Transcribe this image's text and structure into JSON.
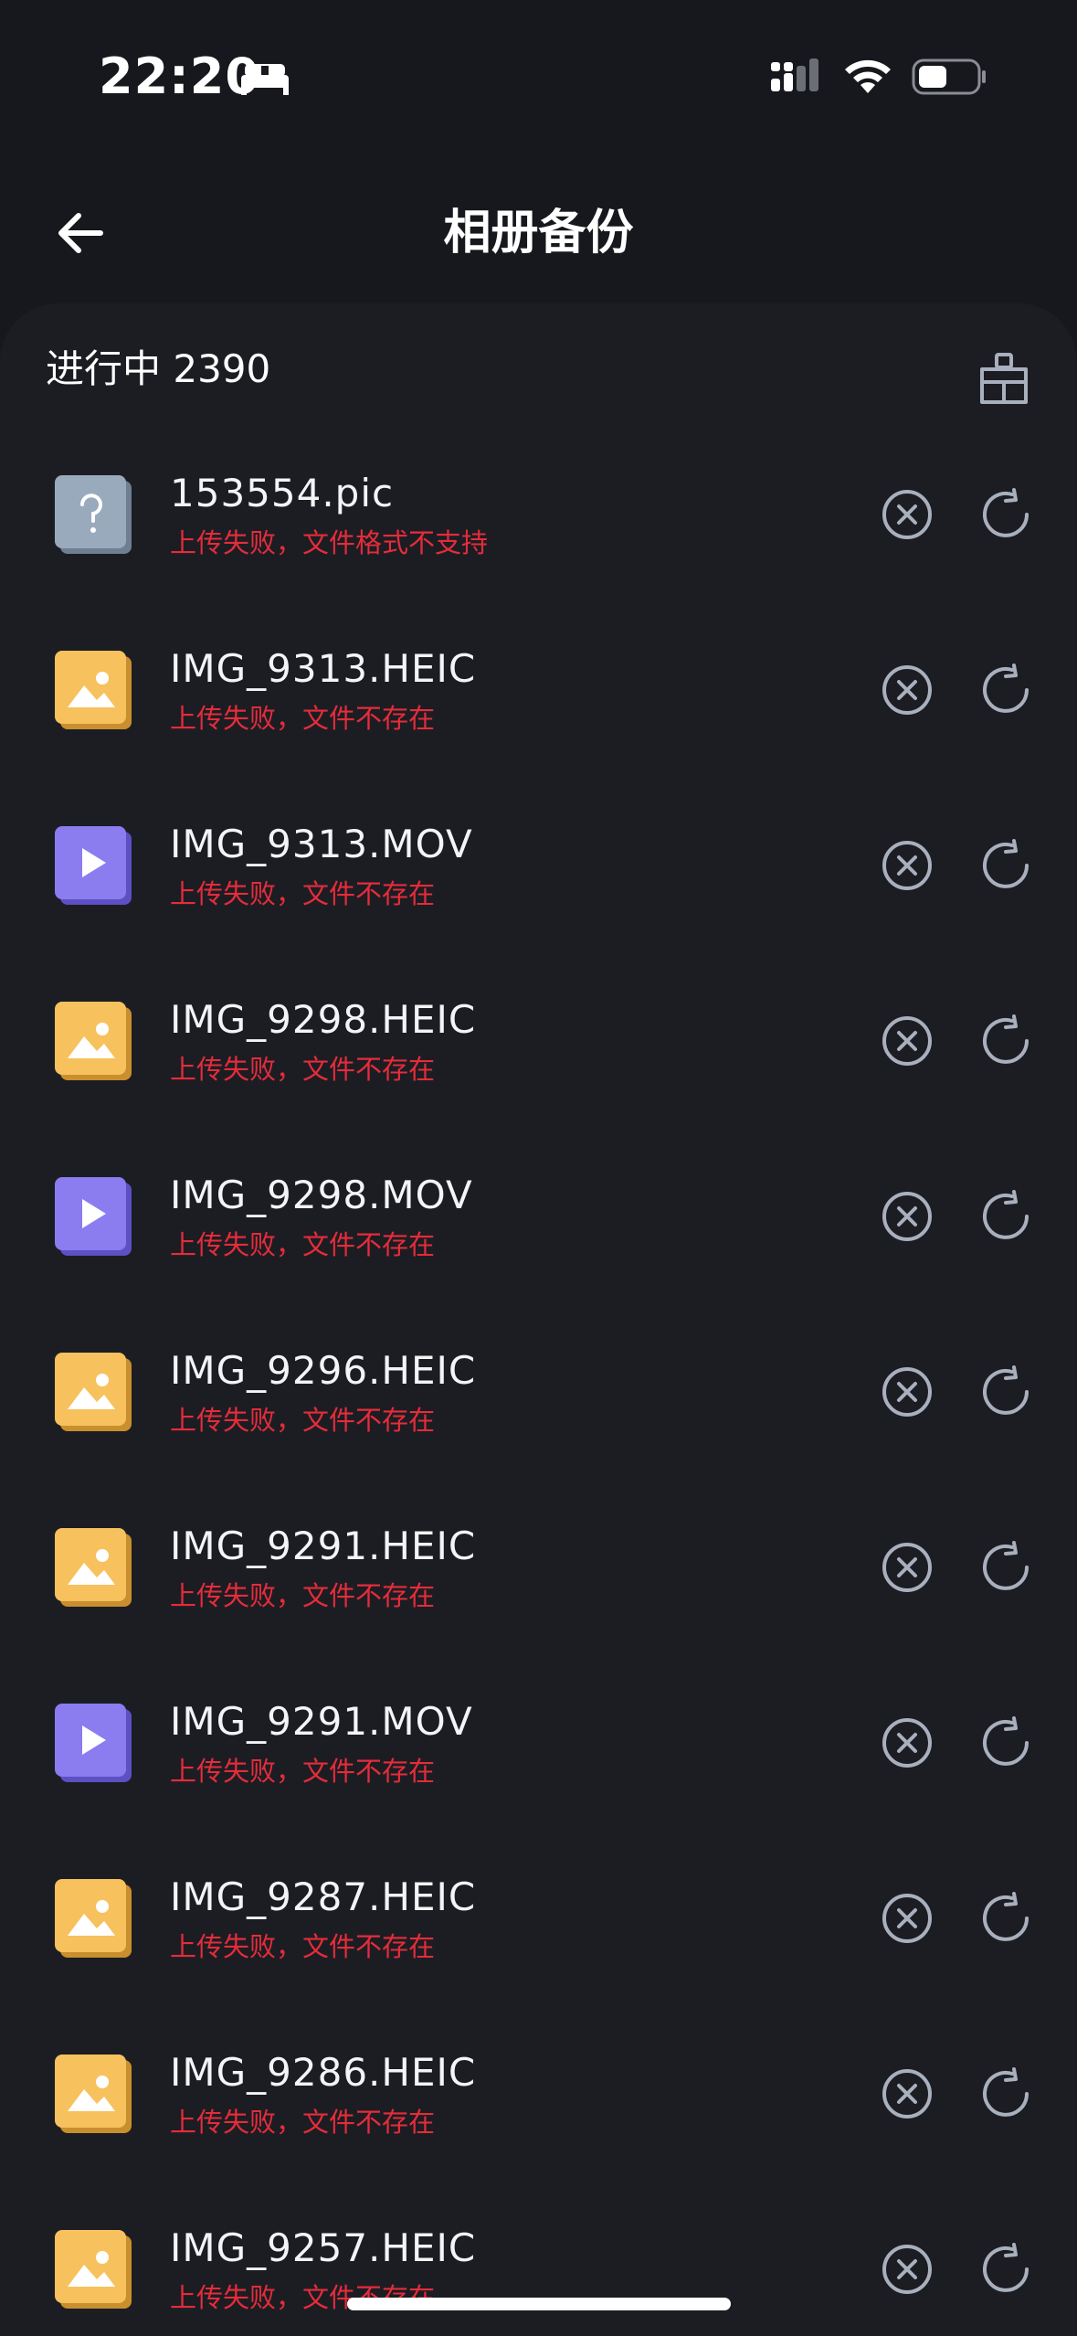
{
  "status_bar": {
    "time": "22:20",
    "icons": [
      "bed-icon",
      "cellular-signal-icon",
      "wifi-icon",
      "battery-icon"
    ]
  },
  "header": {
    "title": "相册备份",
    "back_icon": "arrow-left-icon"
  },
  "section": {
    "label": "进行中 2390",
    "clean_icon": "broom-icon"
  },
  "files": [
    {
      "name": "153554.pic",
      "status": "上传失败，文件格式不支持",
      "type": "unknown"
    },
    {
      "name": "IMG_9313.HEIC",
      "status": "上传失败，文件不存在",
      "type": "image"
    },
    {
      "name": "IMG_9313.MOV",
      "status": "上传失败，文件不存在",
      "type": "video"
    },
    {
      "name": "IMG_9298.HEIC",
      "status": "上传失败，文件不存在",
      "type": "image"
    },
    {
      "name": "IMG_9298.MOV",
      "status": "上传失败，文件不存在",
      "type": "video"
    },
    {
      "name": "IMG_9296.HEIC",
      "status": "上传失败，文件不存在",
      "type": "image"
    },
    {
      "name": "IMG_9291.HEIC",
      "status": "上传失败，文件不存在",
      "type": "image"
    },
    {
      "name": "IMG_9291.MOV",
      "status": "上传失败，文件不存在",
      "type": "video"
    },
    {
      "name": "IMG_9287.HEIC",
      "status": "上传失败，文件不存在",
      "type": "image"
    },
    {
      "name": "IMG_9286.HEIC",
      "status": "上传失败，文件不存在",
      "type": "image"
    },
    {
      "name": "IMG_9257.HEIC",
      "status": "上传失败，文件不存在",
      "type": "image"
    }
  ],
  "colors": {
    "background": "#16181d",
    "panel": "#1c1d23",
    "error_text": "#e52c3a",
    "image_icon": "#f7c15e",
    "video_icon": "#8b7cf0",
    "unknown_icon": "#9aaabd",
    "action_icon": "#a9b0bd"
  }
}
